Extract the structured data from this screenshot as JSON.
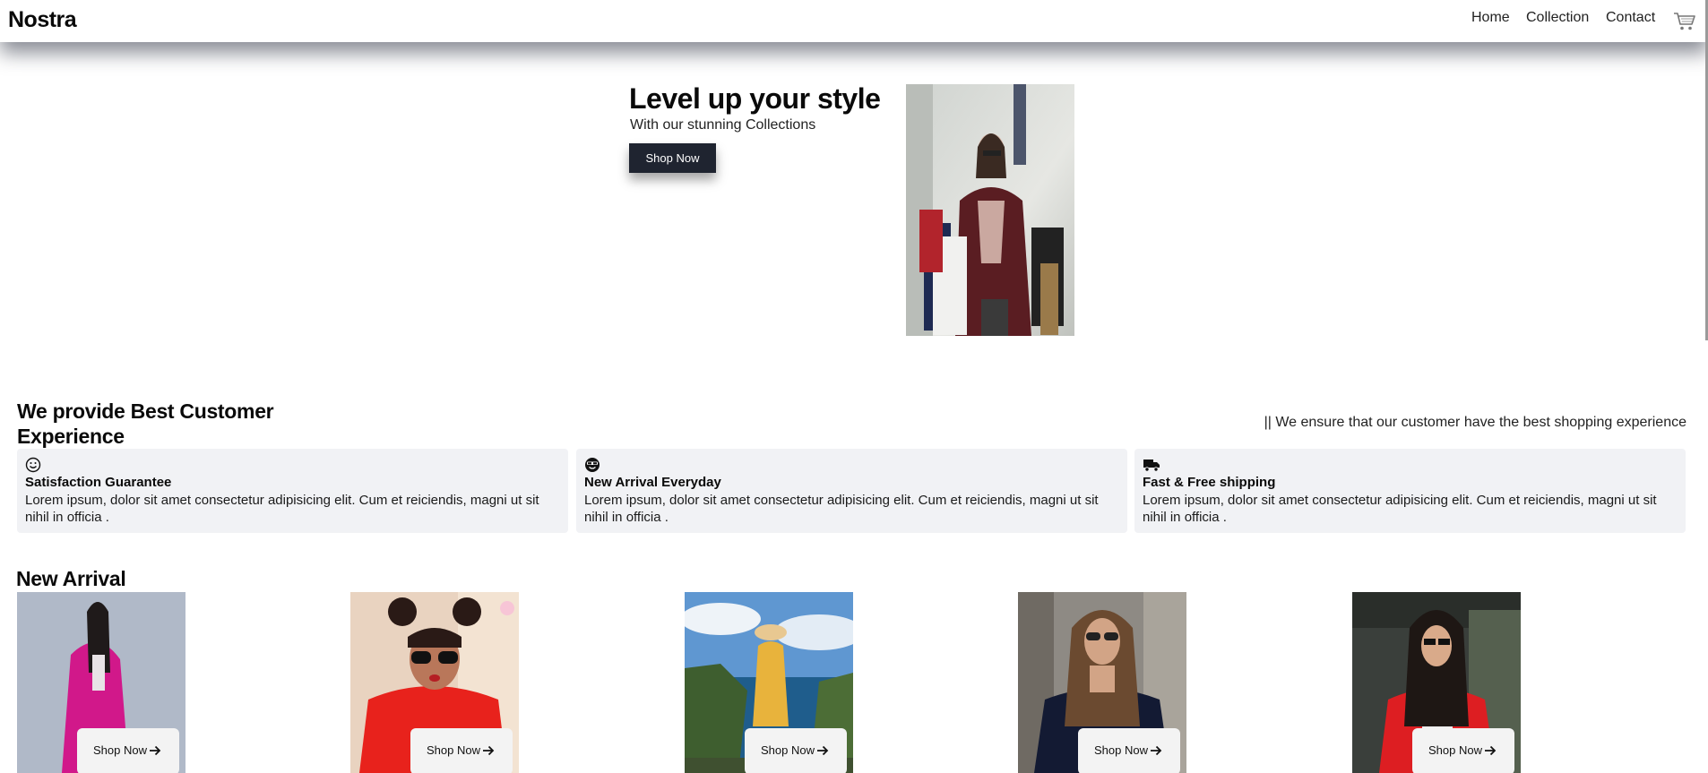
{
  "header": {
    "brand": "Nostra",
    "nav": [
      "Home",
      "Collection",
      "Contact"
    ],
    "cart_icon": "shopping-cart-icon"
  },
  "hero": {
    "title": "Level up your style",
    "subtitle": "With our stunning Collections",
    "button": "Shop Now"
  },
  "experience": {
    "title": "We provide Best Customer Experience",
    "tagline": "|| We ensure that our customer have the best shopping experience",
    "cards": [
      {
        "icon": "smile-icon",
        "title": "Satisfaction Guarantee",
        "text": "Lorem ipsum, dolor sit amet consectetur adipisicing elit. Cum et reiciendis, magni ut sit nihil in officia ."
      },
      {
        "icon": "cool-face-icon",
        "title": "New Arrival Everyday",
        "text": "Lorem ipsum, dolor sit amet consectetur adipisicing elit. Cum et reiciendis, magni ut sit nihil in officia ."
      },
      {
        "icon": "truck-icon",
        "title": "Fast & Free shipping",
        "text": "Lorem ipsum, dolor sit amet consectetur adipisicing elit. Cum et reiciendis, magni ut sit nihil in officia ."
      }
    ]
  },
  "new_arrival": {
    "title": "New Arrival",
    "products": [
      {
        "button": "Shop Now"
      },
      {
        "button": "Shop Now"
      },
      {
        "button": "Shop Now"
      },
      {
        "button": "Shop Now"
      },
      {
        "button": "Shop Now"
      }
    ]
  }
}
